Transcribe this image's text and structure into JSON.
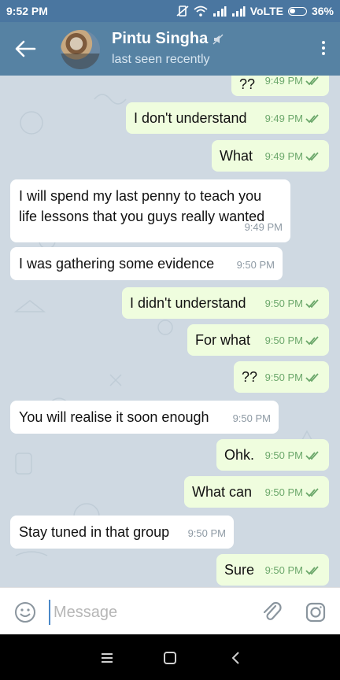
{
  "status_bar": {
    "time": "9:52 PM",
    "network": "VoLTE",
    "battery": "36%",
    "icons": [
      "vibrate-off-icon",
      "wifi-icon",
      "signal-icon",
      "signal-icon",
      "battery-icon"
    ]
  },
  "header": {
    "contact_name": "Pintu Singha",
    "status": "last seen recently",
    "icons": [
      "back-arrow-icon",
      "avatar",
      "mute-icon",
      "more-vert-icon"
    ]
  },
  "messages": [
    {
      "direction": "out",
      "text": "??",
      "time": "9:49 PM",
      "read": true
    },
    {
      "direction": "out",
      "text": "I don't understand",
      "time": "9:49 PM",
      "read": true
    },
    {
      "direction": "out",
      "text": "What",
      "time": "9:49 PM",
      "read": true
    },
    {
      "direction": "in",
      "text": "I will spend my last penny to teach you\nlife lessons that you guys really wanted",
      "time": "9:49 PM"
    },
    {
      "direction": "in",
      "text": "I was gathering some evidence",
      "time": "9:50 PM"
    },
    {
      "direction": "out",
      "text": "I didn't understand",
      "time": "9:50 PM",
      "read": true
    },
    {
      "direction": "out",
      "text": "For what",
      "time": "9:50 PM",
      "read": true
    },
    {
      "direction": "out",
      "text": "??",
      "time": "9:50 PM",
      "read": true
    },
    {
      "direction": "in",
      "text": "You will realise it soon enough",
      "time": "9:50 PM"
    },
    {
      "direction": "out",
      "text": "Ohk.",
      "time": "9:50 PM",
      "read": true
    },
    {
      "direction": "out",
      "text": "What can",
      "time": "9:50 PM",
      "read": true
    },
    {
      "direction": "in",
      "text": "Stay tuned in that group",
      "time": "9:50 PM"
    },
    {
      "direction": "out",
      "text": "Sure",
      "time": "9:50 PM",
      "read": true
    }
  ],
  "input": {
    "placeholder": "Message",
    "value": "",
    "icons": [
      "emoji-icon",
      "attach-icon",
      "camera-icon"
    ]
  },
  "nav_bar": {
    "icons": [
      "recents-icon",
      "home-icon",
      "back-icon"
    ]
  },
  "colors": {
    "status_bar": "#4a76a0",
    "header": "#5682a3",
    "chat_bg": "#cfd9e2",
    "outgoing_bubble": "#effdde",
    "incoming_bubble": "#ffffff",
    "read_ticks": "#6ca86b"
  }
}
